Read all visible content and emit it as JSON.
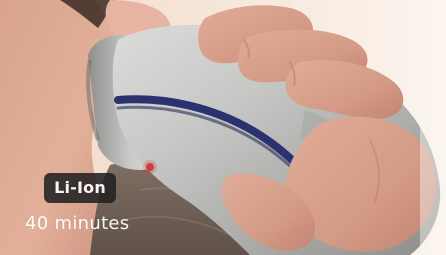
{
  "badge": {
    "label": "Li-Ion"
  },
  "runtime": {
    "text": "40 minutes"
  },
  "colors": {
    "badge_background": "#222222",
    "badge_text": "#ffffff",
    "caption_text": "#ffffff",
    "shaver_accent": "#2b3270"
  },
  "scene": {
    "subject": "shaver-in-hand",
    "device_color": "#b8b8b6"
  }
}
